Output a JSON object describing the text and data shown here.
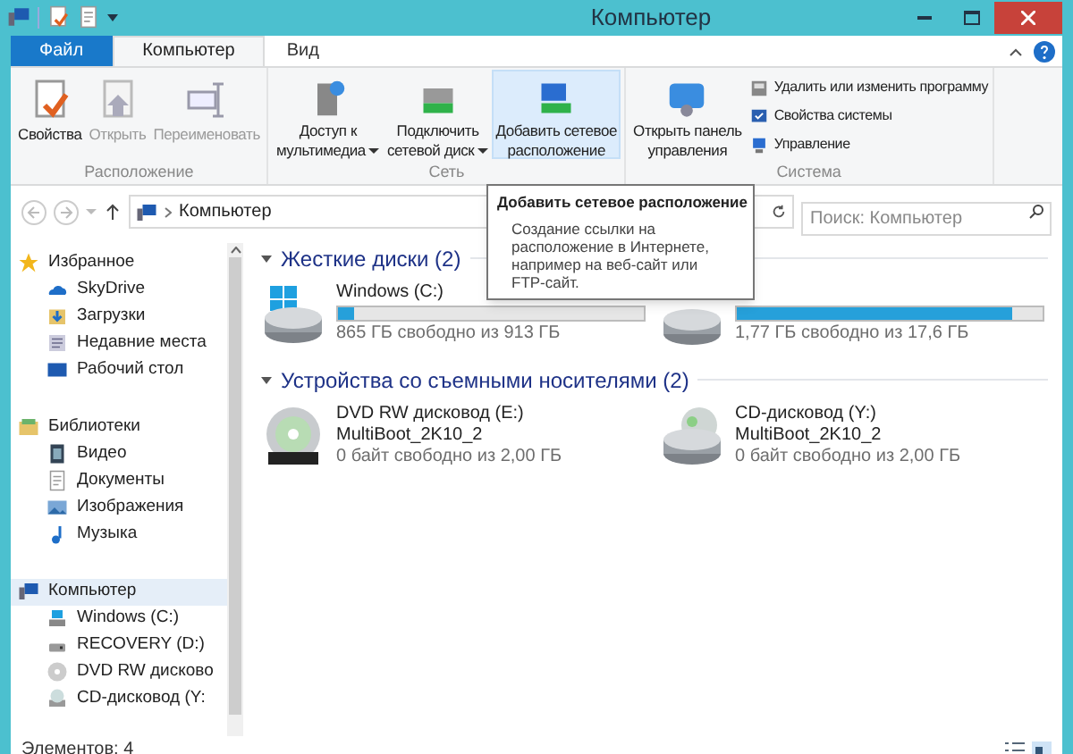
{
  "window": {
    "title": "Компьютер"
  },
  "tabs": [
    {
      "label": "Файл",
      "kind": "file",
      "selected": false
    },
    {
      "label": "Компьютер",
      "kind": "tab",
      "selected": true
    },
    {
      "label": "Вид",
      "kind": "tab",
      "selected": false
    }
  ],
  "ribbon": {
    "groups": [
      {
        "label": "Расположение",
        "buttons": [
          {
            "lines": [
              "Свойства"
            ],
            "disabled": false,
            "hovered": false,
            "dropdown": false
          },
          {
            "lines": [
              "Открыть"
            ],
            "disabled": true,
            "hovered": false,
            "dropdown": false
          },
          {
            "lines": [
              "Переименовать"
            ],
            "disabled": true,
            "hovered": false,
            "dropdown": false
          }
        ]
      },
      {
        "label": "Сеть",
        "buttons": [
          {
            "lines": [
              "Доступ к",
              "мультимедиа"
            ],
            "disabled": false,
            "hovered": false,
            "dropdown": true
          },
          {
            "lines": [
              "Подключить",
              "сетевой диск"
            ],
            "disabled": false,
            "hovered": false,
            "dropdown": true
          },
          {
            "lines": [
              "Добавить сетевое",
              "расположение"
            ],
            "disabled": false,
            "hovered": true,
            "dropdown": false
          }
        ]
      },
      {
        "label": "Система",
        "buttons": [
          {
            "lines": [
              "Открыть панель",
              "управления"
            ],
            "disabled": false,
            "hovered": false,
            "dropdown": false
          }
        ],
        "small_items": [
          {
            "label": "Удалить или изменить программу"
          },
          {
            "label": "Свойства системы"
          },
          {
            "label": "Управление"
          }
        ]
      }
    ]
  },
  "address": {
    "path": "Компьютер",
    "search_placeholder": "Поиск: Компьютер"
  },
  "tooltip": {
    "title": "Добавить сетевое расположение",
    "text": "Создание ссылки на расположение в Интернете, например на веб-сайт или FTP-сайт."
  },
  "sidebar": {
    "items": [
      {
        "label": "Избранное",
        "selected": false,
        "children": [
          {
            "label": "SkyDrive"
          },
          {
            "label": "Загрузки"
          },
          {
            "label": "Недавние места"
          },
          {
            "label": "Рабочий стол"
          }
        ]
      },
      {
        "label": "Библиотеки",
        "selected": false,
        "children": [
          {
            "label": "Видео"
          },
          {
            "label": "Документы"
          },
          {
            "label": "Изображения"
          },
          {
            "label": "Музыка"
          }
        ]
      },
      {
        "label": "Компьютер",
        "selected": true,
        "children": [
          {
            "label": "Windows (C:)"
          },
          {
            "label": "RECOVERY (D:)"
          },
          {
            "label": "DVD RW дисково"
          },
          {
            "label": "CD-дисковод (Y:"
          }
        ]
      }
    ]
  },
  "groups": [
    {
      "title": "Жесткие диски (2)",
      "items": [
        {
          "kind": "disk",
          "name": "Windows (C:)",
          "level": 0.05,
          "free": "865 ГБ свободно из 913 ГБ"
        },
        {
          "kind": "disk",
          "level": 0.9,
          "free": "1,77 ГБ свободно из 17,6 ГБ"
        }
      ]
    },
    {
      "title": "Устройства со съемными носителями (2)",
      "items": [
        {
          "kind": "removable",
          "name": "DVD RW дисковод (E:)",
          "volume": "MultiBoot_2K10_2",
          "free": "0 байт свободно из 2,00 ГБ"
        },
        {
          "kind": "removable",
          "name": "CD-дисковод (Y:)",
          "volume": "MultiBoot_2K10_2",
          "free": "0 байт свободно из 2,00 ГБ"
        }
      ]
    }
  ],
  "status_bar": {
    "text": "Элементов: 4"
  }
}
